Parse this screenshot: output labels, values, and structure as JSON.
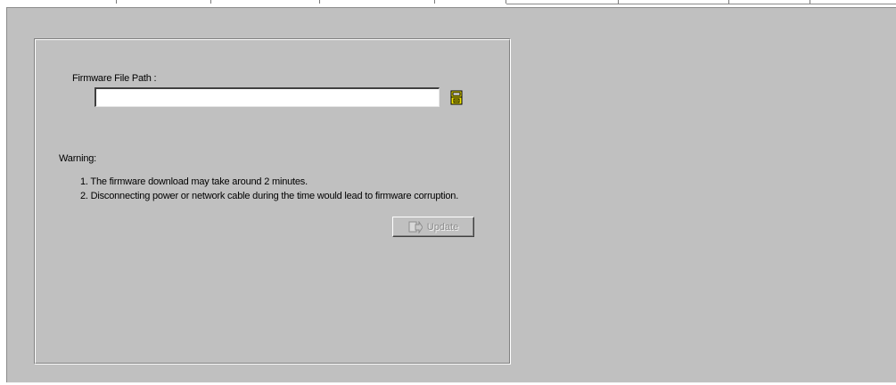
{
  "firmware": {
    "path_label": "Firmware File Path :",
    "path_value": "",
    "browse_icon": "folder-open-icon",
    "warning_title": "Warning:",
    "warnings": [
      "1. The firmware download may take around 2 minutes.",
      "2. Disconnecting power or network cable during the time would  lead to firmware corruption."
    ],
    "update_label": "Update",
    "update_icon": "update-arrow-icon",
    "update_enabled": false
  },
  "colors": {
    "panel_background": "#c0c0c0",
    "disabled_text": "#8c8c8c",
    "icon_yellow": "#f2e600"
  }
}
